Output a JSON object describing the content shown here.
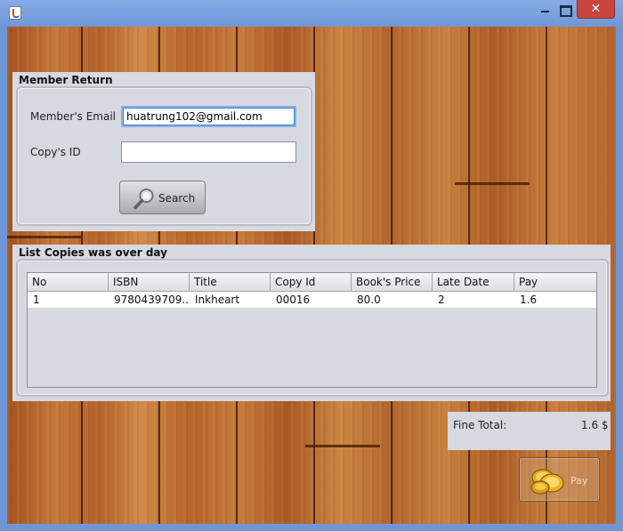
{
  "window": {
    "close_glyph": "✕",
    "icons": {
      "app": "java-cup-icon",
      "minimize": "minimize-icon",
      "maximize": "maximize-icon",
      "close": "close-icon"
    }
  },
  "member_return": {
    "title": "Member Return",
    "email_label": "Member's Email",
    "email_value": "huatrung102@gmail.com",
    "copy_id_label": "Copy's ID",
    "copy_id_value": "",
    "search_label": "Search",
    "search_icon": "magnifier-icon"
  },
  "overdue_list": {
    "title": "List Copies was over day",
    "columns": [
      "No",
      "ISBN",
      "Title",
      "Copy Id",
      "Book's Price",
      "Late Date",
      "Pay"
    ],
    "rows": [
      [
        "1",
        "9780439709...",
        "Inkheart",
        "00016",
        "80.0",
        "2",
        "1.6"
      ]
    ]
  },
  "fine": {
    "label": "Fine Total:",
    "value": "1.6 $"
  },
  "pay": {
    "label": "Pay",
    "icon": "gold-coins-icon"
  },
  "colors": {
    "panel_bg": "#d7d9e1",
    "titlebar": "#7aa2e0",
    "close_button": "#c9463d",
    "wood": "#b86a2e"
  }
}
